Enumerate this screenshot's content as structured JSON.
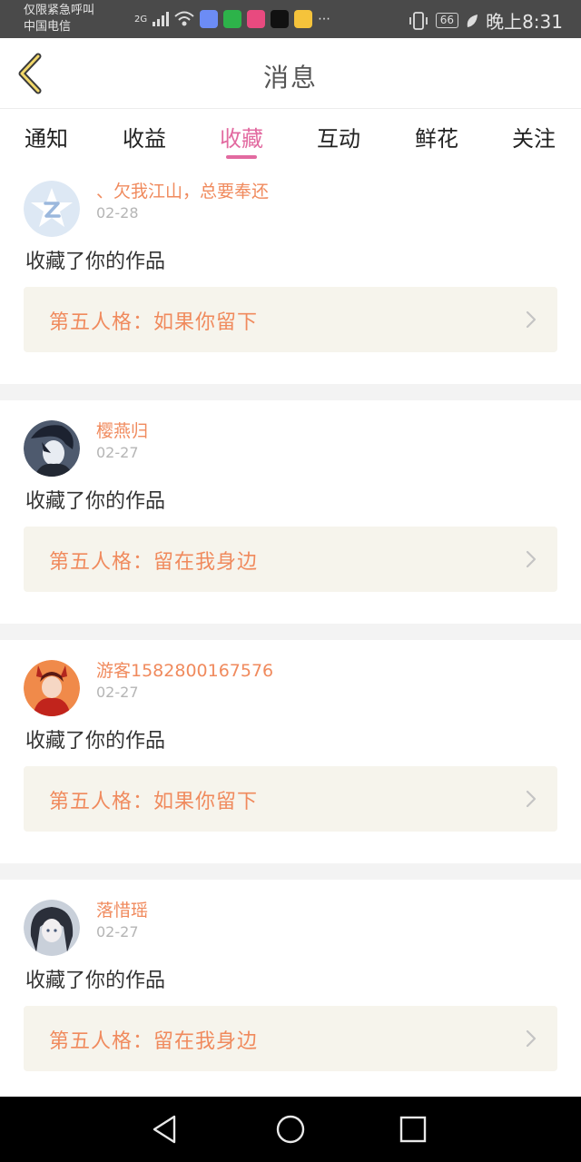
{
  "status_bar": {
    "carrier_line1": "仅限紧急呼叫",
    "carrier_line2": "中国电信",
    "signal_label": "2G",
    "more_icon": "⋯",
    "battery": "66",
    "time": "晚上8:31"
  },
  "header": {
    "back_icon": "chevron-left-icon",
    "title": "消息"
  },
  "tabs": [
    {
      "label": "通知",
      "active": false
    },
    {
      "label": "收益",
      "active": false
    },
    {
      "label": "收藏",
      "active": true
    },
    {
      "label": "互动",
      "active": false
    },
    {
      "label": "鲜花",
      "active": false
    },
    {
      "label": "关注",
      "active": false
    }
  ],
  "colors": {
    "accent": "#e26aa0",
    "name": "#f08a5d",
    "work_bg": "#f6f4ec"
  },
  "items": [
    {
      "username": "、欠我江山，总要奉还",
      "date": "02-28",
      "action": "收藏了你的作品",
      "work": "第五人格：如果你留下"
    },
    {
      "username": "樱燕归",
      "date": "02-27",
      "action": "收藏了你的作品",
      "work": "第五人格：留在我身边"
    },
    {
      "username": "游客1582800167576",
      "date": "02-27",
      "action": "收藏了你的作品",
      "work": "第五人格：如果你留下"
    },
    {
      "username": "落惜瑶",
      "date": "02-27",
      "action": "收藏了你的作品",
      "work": "第五人格：留在我身边"
    }
  ]
}
